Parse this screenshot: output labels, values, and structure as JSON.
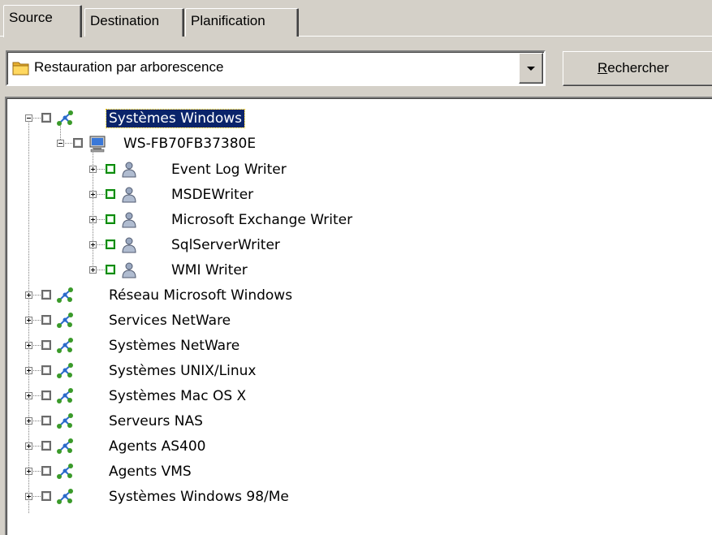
{
  "tabs": [
    {
      "label": "Source",
      "active": true
    },
    {
      "label": "Destination",
      "active": false
    },
    {
      "label": "Planification",
      "active": false
    }
  ],
  "view_select": {
    "value": "Restauration par arborescence",
    "icon": "folder-icon"
  },
  "search_button": {
    "mnemonic": "R",
    "rest": "echercher"
  },
  "tree": {
    "root": {
      "label": "Systèmes Windows",
      "icon": "network-icon",
      "expanded": true,
      "selected": true
    },
    "host": {
      "label": "WS-FB70FB37380E",
      "icon": "computer-icon",
      "expanded": true
    },
    "writers": [
      {
        "label": "Event Log Writer",
        "icon": "writer-icon"
      },
      {
        "label": "MSDEWriter",
        "icon": "writer-icon"
      },
      {
        "label": "Microsoft Exchange Writer",
        "icon": "writer-icon"
      },
      {
        "label": "SqlServerWriter",
        "icon": "writer-icon"
      },
      {
        "label": "WMI Writer",
        "icon": "writer-icon"
      }
    ],
    "groups": [
      {
        "label": "Réseau Microsoft Windows",
        "icon": "network-icon"
      },
      {
        "label": "Services NetWare",
        "icon": "network-icon"
      },
      {
        "label": "Systèmes NetWare",
        "icon": "network-icon"
      },
      {
        "label": "Systèmes UNIX/Linux",
        "icon": "network-icon"
      },
      {
        "label": "Systèmes Mac OS X",
        "icon": "network-icon"
      },
      {
        "label": "Serveurs NAS",
        "icon": "network-icon"
      },
      {
        "label": "Agents AS400",
        "icon": "network-icon"
      },
      {
        "label": "Agents VMS",
        "icon": "network-icon"
      },
      {
        "label": "Systèmes Windows 98/Me",
        "icon": "network-icon"
      }
    ]
  },
  "colors": {
    "selection": "#0a246a",
    "checkbox_green": "#0a8a0a",
    "window_bg": "#d4d0c8"
  }
}
